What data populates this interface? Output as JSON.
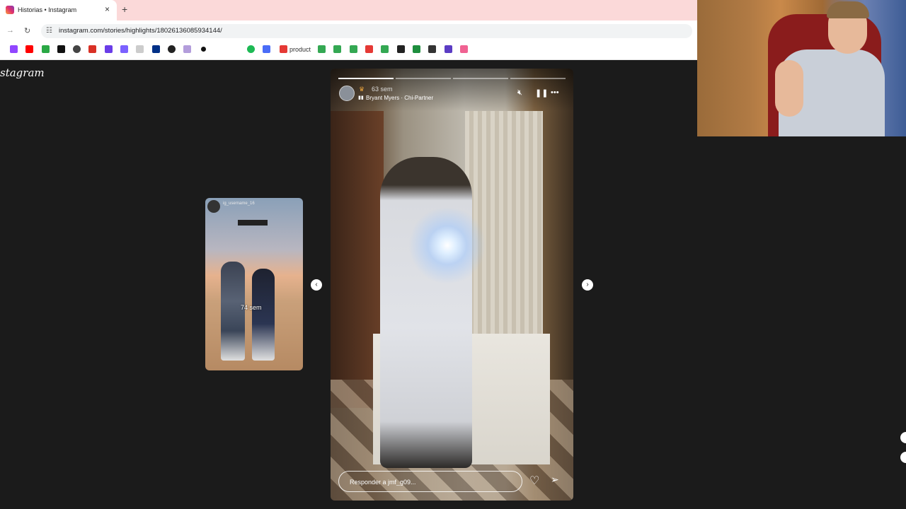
{
  "browser": {
    "tab_title": "Historias • Instagram",
    "tab_close": "×",
    "new_tab": "+",
    "url": "instagram.com/stories/highlights/18026136085934144/",
    "bookmark_label": "product"
  },
  "instagram": {
    "logo": "stagram",
    "prev_story": {
      "time": "74 sem",
      "username": "ig_username_16"
    },
    "story": {
      "time": "63 sem",
      "music": "Bryant Myers · Chi-Partner",
      "reply_placeholder": "Responder a jmf_g09..."
    },
    "nav": {
      "prev": "‹",
      "next": "›"
    }
  }
}
